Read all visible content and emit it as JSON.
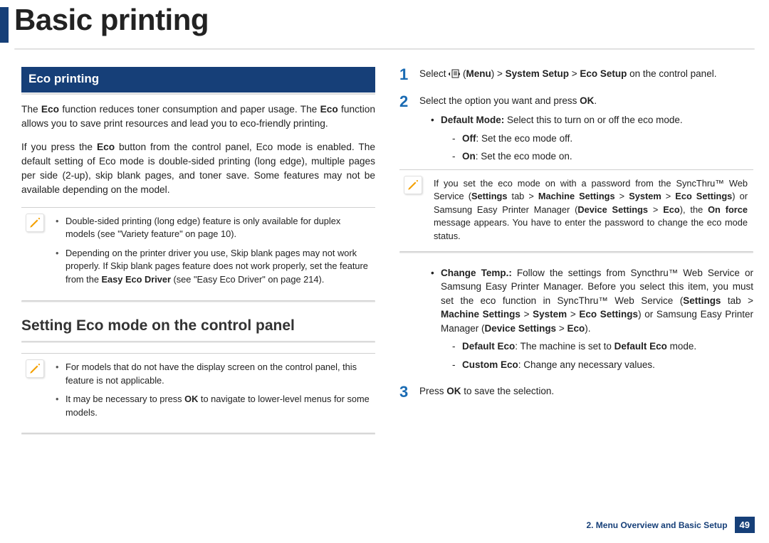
{
  "page_title": "Basic printing",
  "left": {
    "section_title": "Eco printing",
    "p1_parts": [
      "The ",
      "Eco",
      " function reduces toner consumption and paper usage. The ",
      "Eco",
      " function allows you to save print resources and lead you to eco-friendly printing."
    ],
    "p2_parts": [
      "If you press the ",
      "Eco",
      " button from the control panel, Eco mode is enabled. The default setting of Eco mode is double-sided printing (long edge), multiple pages per side (2-up), skip blank pages, and toner save. Some features may not be available depending on the model."
    ],
    "note1_li1": "Double-sided printing (long edge) feature is only available for duplex models (see \"Variety feature\" on page 10).",
    "note1_li2_parts": [
      "Depending on the printer driver you use, Skip blank pages may not work properly. If Skip blank pages feature does not work properly, set the feature from the ",
      "Easy Eco Driver",
      " (see \"Easy Eco Driver\" on page 214)."
    ],
    "subheading": "Setting Eco mode on the control panel",
    "note2_li1": "For models that do not have the display screen on the control panel, this feature is not applicable.",
    "note2_li2_parts": [
      "It may be necessary to press ",
      "OK",
      " to navigate to lower-level menus for some models."
    ]
  },
  "right": {
    "step1_parts": [
      "Select ",
      " (",
      "Menu",
      ") > ",
      "System Setup",
      " > ",
      "Eco Setup",
      " on the control panel."
    ],
    "step2_parts": [
      "Select the option you want and press ",
      "OK",
      "."
    ],
    "opt_default_mode_parts": [
      "Default Mode: ",
      "Select this to turn on or off the eco mode."
    ],
    "opt_off_parts": [
      "Off",
      ": Set the eco mode off."
    ],
    "opt_on_parts": [
      "On",
      ": Set the eco mode on."
    ],
    "note3_parts": [
      "If you set the eco mode on with a password from the SyncThru™ Web Service (",
      "Settings",
      " tab > ",
      "Machine Settings",
      " > ",
      "System",
      " > ",
      "Eco Settings",
      ") or Samsung Easy Printer Manager (",
      "Device Settings",
      " > ",
      "Eco",
      "), the ",
      "On force",
      " message appears. You have to enter the password to change the eco mode status."
    ],
    "opt_change_temp_parts": [
      "Change Temp.: ",
      "Follow the settings from Syncthru™ Web Service or Samsung Easy Printer Manager. Before you select this item, you must set the eco function in SyncThru™ Web Service (",
      "Settings",
      " tab > ",
      "Machine Settings",
      " > ",
      "System",
      " > ",
      "Eco Settings",
      ") or Samsung Easy Printer Manager (",
      "Device Settings",
      " > ",
      "Eco",
      ")."
    ],
    "opt_default_eco_parts": [
      "Default Eco",
      ": The machine is set to ",
      "Default Eco",
      " mode."
    ],
    "opt_custom_eco_parts": [
      "Custom Eco",
      ": Change any necessary values."
    ],
    "step3_parts": [
      "Press ",
      "OK",
      " to save the selection."
    ]
  },
  "footer": {
    "chapter": "2. Menu Overview and Basic Setup",
    "page": "49"
  }
}
